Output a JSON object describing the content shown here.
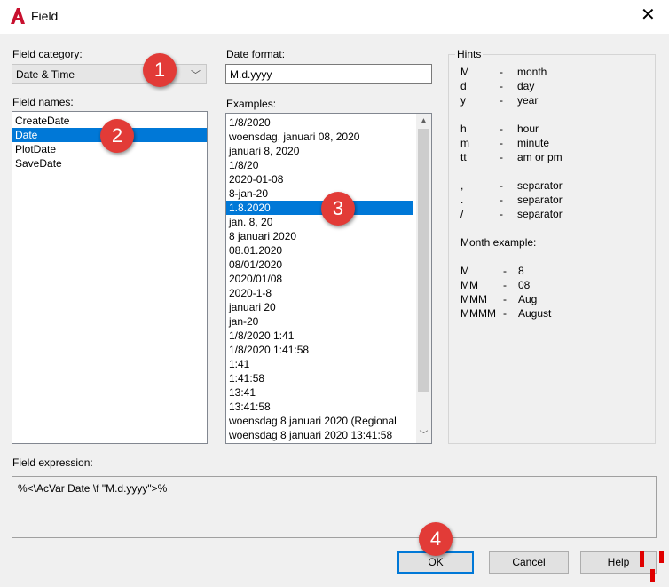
{
  "window": {
    "title": "Field",
    "close_glyph": "✕"
  },
  "field_category": {
    "label": "Field category:",
    "value": "Date & Time",
    "chevron": "﹀"
  },
  "field_names": {
    "label": "Field names:",
    "items": [
      "CreateDate",
      "Date",
      "PlotDate",
      "SaveDate"
    ],
    "selected_index": 1
  },
  "date_format": {
    "label": "Date format:",
    "value": "M.d.yyyy"
  },
  "examples": {
    "label": "Examples:",
    "items": [
      "1/8/2020",
      "woensdag, januari 08, 2020",
      "januari 8, 2020",
      "1/8/20",
      "2020-01-08",
      "8-jan-20",
      "1.8.2020",
      "jan. 8, 20",
      "8 januari 2020",
      "08.01.2020",
      "08/01/2020",
      "2020/01/08",
      "2020-1-8",
      "januari 20",
      "jan-20",
      "1/8/2020 1:41",
      "1/8/2020 1:41:58",
      "1:41",
      "1:41:58",
      "13:41",
      "13:41:58",
      "woensdag 8 januari 2020 (Regional",
      "woensdag 8 januari 2020 13:41:58"
    ],
    "selected_index": 6
  },
  "hints": {
    "title": "Hints",
    "rows": [
      {
        "key": "M",
        "dash": "-",
        "desc": "month"
      },
      {
        "key": "d",
        "dash": "-",
        "desc": "day"
      },
      {
        "key": "y",
        "dash": "-",
        "desc": "year"
      },
      {
        "key": "h",
        "dash": "-",
        "desc": "hour"
      },
      {
        "key": "m",
        "dash": "-",
        "desc": "minute"
      },
      {
        "key": "tt",
        "dash": "-",
        "desc": "am or pm"
      },
      {
        "key": ",",
        "dash": "-",
        "desc": "separator"
      },
      {
        "key": ".",
        "dash": "-",
        "desc": "separator"
      },
      {
        "key": "/",
        "dash": "-",
        "desc": "separator"
      }
    ],
    "month_example_label": "Month example:",
    "month_rows": [
      {
        "key": "M",
        "dash": "-",
        "desc": "8"
      },
      {
        "key": "MM",
        "dash": "-",
        "desc": "08"
      },
      {
        "key": "MMM",
        "dash": "-",
        "desc": "Aug"
      },
      {
        "key": "MMMM",
        "dash": "-",
        "desc": "August"
      }
    ]
  },
  "field_expression": {
    "label": "Field expression:",
    "value": "%<\\AcVar Date \\f \"M.d.yyyy\">%"
  },
  "buttons": {
    "ok": "OK",
    "cancel": "Cancel",
    "help": "Help"
  },
  "badges": [
    "1",
    "2",
    "3",
    "4"
  ],
  "colors": {
    "selection": "#0078d7",
    "badge": "#e23b37",
    "logo": "#c8102e"
  }
}
